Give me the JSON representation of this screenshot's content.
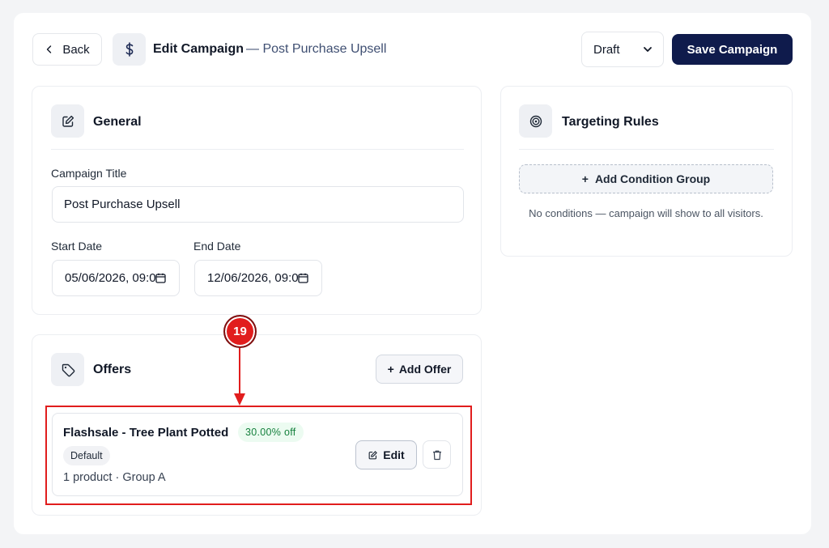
{
  "header": {
    "back_label": "Back",
    "title": "Edit Campaign",
    "subtitle": "— Post Purchase Upsell",
    "status_value": "Draft",
    "save_label": "Save Campaign"
  },
  "general": {
    "title": "General",
    "campaign_title_label": "Campaign Title",
    "campaign_title_value": "Post Purchase Upsell",
    "start_date_label": "Start Date",
    "start_date_value": "05/06/2026, 09:00",
    "end_date_label": "End Date",
    "end_date_value": "12/06/2026, 09:00"
  },
  "offers": {
    "title": "Offers",
    "add_label": "Add Offer",
    "items": [
      {
        "name": "Flashsale - Tree Plant Potted",
        "discount": "30.00% off",
        "badge": "Default",
        "meta": "1 product · Group A",
        "edit_label": "Edit"
      }
    ]
  },
  "targeting": {
    "title": "Targeting Rules",
    "add_label": "Add Condition Group",
    "empty_note": "No conditions — campaign will show to all visitors."
  },
  "annotation": {
    "step_number": "19",
    "color": "#e11d1d"
  },
  "colors": {
    "primary": "#0f1b4c",
    "success_bg": "#ecfbf1",
    "success_text": "#15803d"
  },
  "icons": {
    "back": "chevron-left-icon",
    "title": "dollar-icon",
    "general": "edit-square-icon",
    "offers": "tag-icon",
    "targeting": "target-icon",
    "status": "chevron-down-icon",
    "date": "calendar-icon",
    "edit": "edit-square-icon",
    "delete": "trash-icon"
  }
}
